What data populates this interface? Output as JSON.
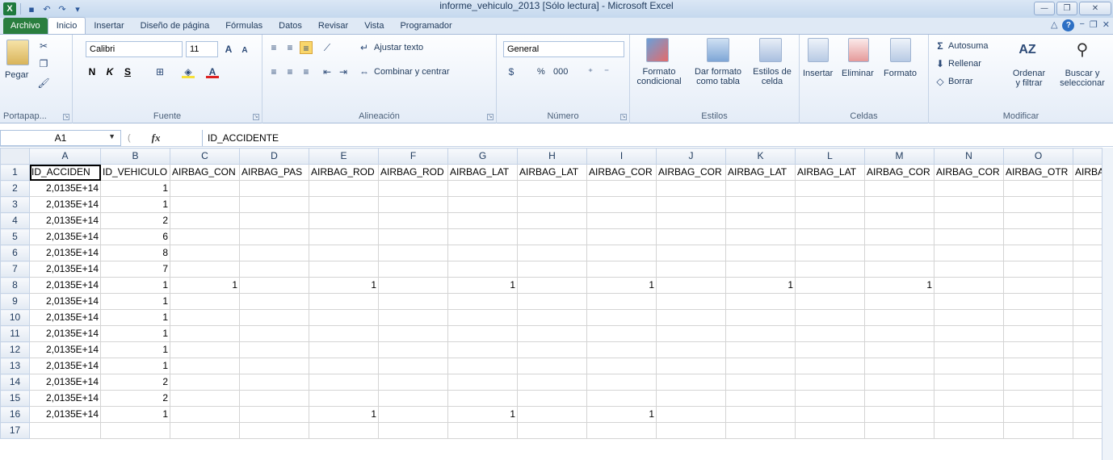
{
  "window": {
    "title": "informe_vehiculo_2013  [Sólo lectura]  -  Microsoft Excel",
    "logo": "X",
    "minimize_glyph": "—",
    "restore_glyph": "❐",
    "close_glyph": "✕"
  },
  "tabs": [
    {
      "label": "Archivo"
    },
    {
      "label": "Inicio"
    },
    {
      "label": "Insertar"
    },
    {
      "label": "Diseño de página"
    },
    {
      "label": "Fórmulas"
    },
    {
      "label": "Datos"
    },
    {
      "label": "Revisar"
    },
    {
      "label": "Vista"
    },
    {
      "label": "Programador"
    }
  ],
  "ribbon": {
    "clipboard": {
      "paste": "Pegar",
      "group": "Portapap..."
    },
    "font": {
      "name": "Calibri",
      "size": "11",
      "bold": "N",
      "italic": "K",
      "underline": "S",
      "group": "Fuente"
    },
    "alignment": {
      "wrap": "Ajustar texto",
      "merge": "Combinar y centrar",
      "group": "Alineación"
    },
    "number": {
      "format": "General",
      "percent": "%",
      "thousands": "000",
      "group": "Número"
    },
    "styles": {
      "conditional_1": "Formato",
      "conditional_2": "condicional",
      "as_table_1": "Dar formato",
      "as_table_2": "como tabla",
      "cell_styles_1": "Estilos de",
      "cell_styles_2": "celda",
      "group": "Estilos"
    },
    "cells": {
      "insert": "Insertar",
      "delete": "Eliminar",
      "format": "Formato",
      "group": "Celdas"
    },
    "editing": {
      "autosum": "Autosuma",
      "fill": "Rellenar",
      "clear": "Borrar",
      "sort_1": "Ordenar",
      "sort_2": "y filtrar",
      "find_1": "Buscar y",
      "find_2": "seleccionar",
      "group": "Modificar"
    }
  },
  "formula_bar": {
    "name_box": "A1",
    "fx": "fx",
    "content": "ID_ACCIDENTE"
  },
  "sheet": {
    "columns": [
      "A",
      "B",
      "C",
      "D",
      "E",
      "F",
      "G",
      "H",
      "I",
      "J",
      "K",
      "L",
      "M",
      "N",
      "O"
    ],
    "headers": [
      "ID_ACCIDEN",
      "ID_VEHICULO",
      "AIRBAG_CON",
      "AIRBAG_PAS",
      "AIRBAG_ROD",
      "AIRBAG_ROD",
      "AIRBAG_LAT",
      "AIRBAG_LAT",
      "AIRBAG_COR",
      "AIRBAG_COR",
      "AIRBAG_LAT",
      "AIRBAG_LAT",
      "AIRBAG_COR",
      "AIRBAG_COR",
      "AIRBAG_OTR",
      "AIRBA"
    ],
    "rows": [
      {
        "n": "2",
        "a": "2,0135E+14",
        "b": "1",
        "c": "",
        "e": "",
        "g": "",
        "i": "",
        "k": "",
        "m": ""
      },
      {
        "n": "3",
        "a": "2,0135E+14",
        "b": "1",
        "c": "",
        "e": "",
        "g": "",
        "i": "",
        "k": "",
        "m": ""
      },
      {
        "n": "4",
        "a": "2,0135E+14",
        "b": "2",
        "c": "",
        "e": "",
        "g": "",
        "i": "",
        "k": "",
        "m": ""
      },
      {
        "n": "5",
        "a": "2,0135E+14",
        "b": "6",
        "c": "",
        "e": "",
        "g": "",
        "i": "",
        "k": "",
        "m": ""
      },
      {
        "n": "6",
        "a": "2,0135E+14",
        "b": "8",
        "c": "",
        "e": "",
        "g": "",
        "i": "",
        "k": "",
        "m": ""
      },
      {
        "n": "7",
        "a": "2,0135E+14",
        "b": "7",
        "c": "",
        "e": "",
        "g": "",
        "i": "",
        "k": "",
        "m": ""
      },
      {
        "n": "8",
        "a": "2,0135E+14",
        "b": "1",
        "c": "1",
        "e": "1",
        "g": "1",
        "i": "1",
        "k": "1",
        "m": "1"
      },
      {
        "n": "9",
        "a": "2,0135E+14",
        "b": "1",
        "c": "",
        "e": "",
        "g": "",
        "i": "",
        "k": "",
        "m": ""
      },
      {
        "n": "10",
        "a": "2,0135E+14",
        "b": "1",
        "c": "",
        "e": "",
        "g": "",
        "i": "",
        "k": "",
        "m": ""
      },
      {
        "n": "11",
        "a": "2,0135E+14",
        "b": "1",
        "c": "",
        "e": "",
        "g": "",
        "i": "",
        "k": "",
        "m": ""
      },
      {
        "n": "12",
        "a": "2,0135E+14",
        "b": "1",
        "c": "",
        "e": "",
        "g": "",
        "i": "",
        "k": "",
        "m": ""
      },
      {
        "n": "13",
        "a": "2,0135E+14",
        "b": "1",
        "c": "",
        "e": "",
        "g": "",
        "i": "",
        "k": "",
        "m": ""
      },
      {
        "n": "14",
        "a": "2,0135E+14",
        "b": "2",
        "c": "",
        "e": "",
        "g": "",
        "i": "",
        "k": "",
        "m": ""
      },
      {
        "n": "15",
        "a": "2,0135E+14",
        "b": "2",
        "c": "",
        "e": "",
        "g": "",
        "i": "",
        "k": "",
        "m": ""
      },
      {
        "n": "16",
        "a": "2,0135E+14",
        "b": "1",
        "c": "",
        "e": "1",
        "g": "1",
        "i": "1",
        "k": "",
        "m": ""
      },
      {
        "n": "17",
        "a": "",
        "b": "",
        "c": "",
        "e": "",
        "g": "",
        "i": "",
        "k": "",
        "m": ""
      }
    ],
    "header_row_number": "1"
  }
}
